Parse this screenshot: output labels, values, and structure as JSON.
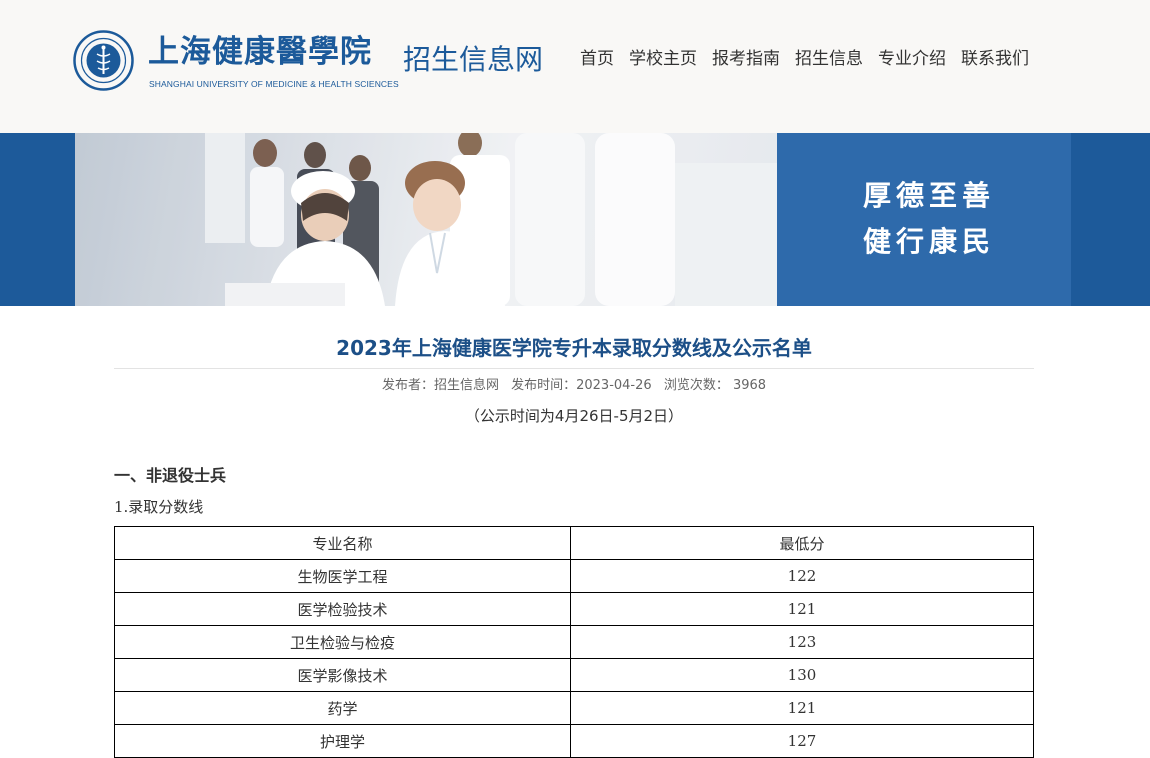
{
  "header": {
    "logo_cn": "上海健康醫學院",
    "logo_en": "SHANGHAI UNIVERSITY OF MEDICINE & HEALTH SCIENCES",
    "site_name": "招生信息网",
    "nav": [
      "首页",
      "学校主页",
      "报考指南",
      "招生信息",
      "专业介绍",
      "联系我们"
    ]
  },
  "banner": {
    "motto_line1": "厚德至善",
    "motto_line2": "健行康民"
  },
  "article": {
    "title": "2023年上海健康医学院专升本录取分数线及公示名单",
    "meta_publisher": "发布者：招生信息网",
    "meta_time": "发布时间：2023-04-26",
    "meta_views": "浏览次数： 3968",
    "notice": "（公示时间为4月26日-5月2日）",
    "section1": "一、非退役士兵",
    "subsection1": "1.录取分数线",
    "table": {
      "headers": [
        "专业名称",
        "最低分"
      ],
      "rows": [
        [
          "生物医学工程",
          "122"
        ],
        [
          "医学检验技术",
          "121"
        ],
        [
          "卫生检验与检疫",
          "123"
        ],
        [
          "医学影像技术",
          "130"
        ],
        [
          "药学",
          "121"
        ],
        [
          "护理学",
          "127"
        ]
      ]
    }
  },
  "colors": {
    "brand_blue": "#1c5a9a",
    "banner_panel": "#2e6aab",
    "title_blue": "#1c4f87"
  }
}
